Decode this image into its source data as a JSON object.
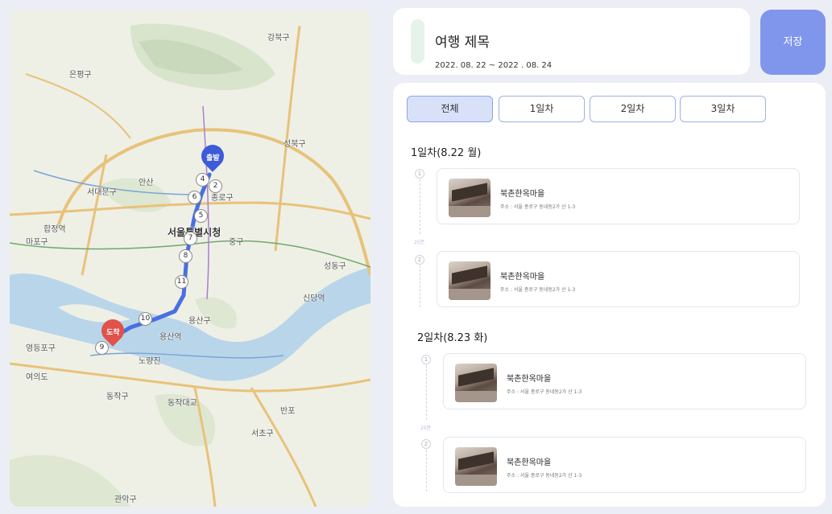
{
  "map": {
    "districts": [
      "강북구",
      "은평구",
      "성북구",
      "서대문구",
      "마포구",
      "종로구",
      "서울특별시청",
      "중구",
      "성동구",
      "용산구",
      "영등포구",
      "동작구",
      "서초구",
      "관악구"
    ],
    "landmarks": [
      "안산",
      "합정역",
      "용산역",
      "신당역",
      "노량진",
      "동작대교",
      "반포",
      "여의도"
    ],
    "route_numbers": [
      "4",
      "2",
      "6",
      "5",
      "7",
      "8",
      "11",
      "10",
      "9"
    ],
    "start_label": "출발",
    "end_label": "도착",
    "route_color": "#4a6fe0"
  },
  "header": {
    "title": "여행 제목",
    "dates": "2022. 08. 22 ~ 2022 . 08. 24"
  },
  "save_label": "저장",
  "tabs": [
    "전체",
    "1일차",
    "2일차",
    "3일차"
  ],
  "days": [
    {
      "heading": "1일차(8.22 월)",
      "gap_label": "25분",
      "places": [
        {
          "index": "1",
          "name": "북촌한옥마을",
          "address": "주소 : 서울 종로구 동네동2가 산 1-3"
        },
        {
          "index": "2",
          "name": "북촌한옥마을",
          "address": "주소 : 서울 종로구 동네동2가 산 1-3"
        }
      ]
    },
    {
      "heading": "2일차(8.23 화)",
      "gap_label": "25분",
      "places": [
        {
          "index": "1",
          "name": "북촌한옥마을",
          "address": "주소 : 서울 종로구 동네동2가 산 1-3"
        },
        {
          "index": "2",
          "name": "북촌한옥마을",
          "address": "주소 : 서울 종로구 동네동2가 산 1-3"
        }
      ]
    }
  ]
}
